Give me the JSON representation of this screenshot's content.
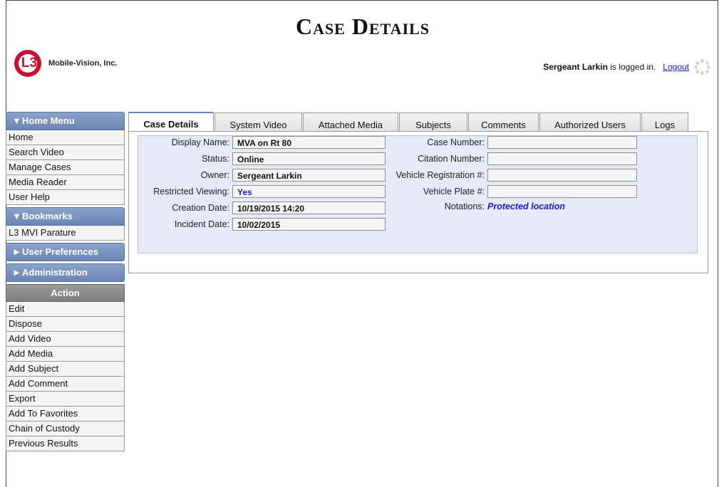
{
  "page": {
    "title": "Case Details"
  },
  "brand": {
    "logo_text": "L3",
    "company": "Mobile-Vision, Inc."
  },
  "session": {
    "user": "Sergeant Larkin",
    "logged_in_suffix": " is logged in.",
    "logout_label": "Logout"
  },
  "sidebar": {
    "home_menu": {
      "header": "Home Menu",
      "items": [
        "Home",
        "Search Video",
        "Manage Cases",
        "Media Reader",
        "User Help"
      ]
    },
    "bookmarks": {
      "header": "Bookmarks",
      "items": [
        "L3 MVI Parature"
      ]
    },
    "user_preferences": {
      "header": "User Preferences"
    },
    "administration": {
      "header": "Administration"
    },
    "action": {
      "header": "Action",
      "items": [
        "Edit",
        "Dispose",
        "Add Video",
        "Add Media",
        "Add Subject",
        "Add Comment",
        "Export",
        "Add To Favorites",
        "Chain of Custody",
        "Previous Results"
      ]
    }
  },
  "tabs": [
    "Case Details",
    "System Video",
    "Attached Media",
    "Subjects",
    "Comments",
    "Authorized Users",
    "Logs"
  ],
  "details": {
    "left": [
      {
        "label": "Display Name:",
        "value": "MVA on Rt 80"
      },
      {
        "label": "Status:",
        "value": "Online"
      },
      {
        "label": "Owner:",
        "value": "Sergeant Larkin"
      },
      {
        "label": "Restricted Viewing:",
        "value": "Yes"
      },
      {
        "label": "Creation Date:",
        "value": "10/19/2015 14:20"
      },
      {
        "label": "Incident Date:",
        "value": "10/02/2015"
      }
    ],
    "right": [
      {
        "label": "Case Number:",
        "value": ""
      },
      {
        "label": "Citation Number:",
        "value": ""
      },
      {
        "label": "Vehicle Registration #:",
        "value": ""
      },
      {
        "label": "Vehicle Plate #:",
        "value": ""
      }
    ],
    "notations_label": "Notations:",
    "notations_value": "Protected location"
  },
  "colors": {
    "menu_header": "#6a85b6",
    "link": "#1a1ad0",
    "logo_red": "#c8102e",
    "panel_bg": "#e6e9f7"
  }
}
